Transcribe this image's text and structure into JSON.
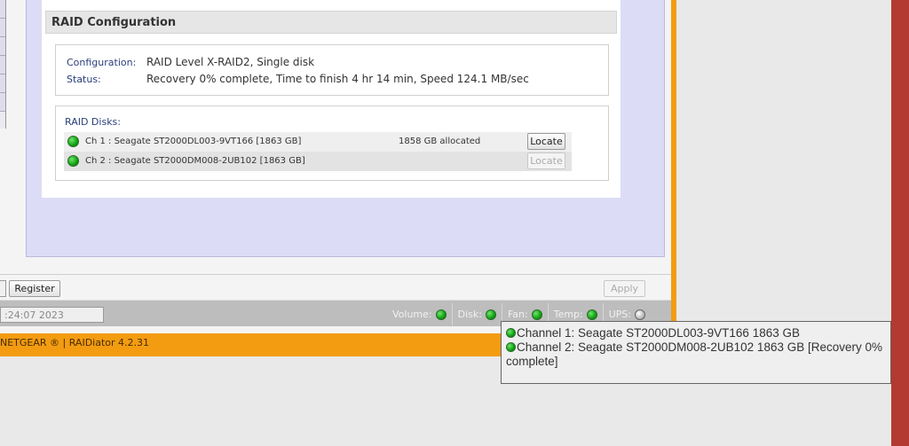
{
  "raid": {
    "title": "RAID Configuration",
    "configuration_label": "Configuration:",
    "configuration_value": "RAID Level X-RAID2, Single disk",
    "status_label": "Status:",
    "status_value": "Recovery 0% complete, Time to finish 4 hr 14 min, Speed 124.1 MB/sec",
    "disks_label": "RAID Disks:",
    "disks": [
      {
        "name": "Ch 1 : Seagate ST2000DL003-9VT166 [1863 GB]",
        "allocated": "1858 GB allocated",
        "button": "Locate",
        "button_enabled": true
      },
      {
        "name": "Ch 2 : Seagate ST2000DM008-2UB102 [1863 GB]",
        "allocated": "",
        "button": "Locate",
        "button_enabled": false
      }
    ]
  },
  "actions": {
    "register_label": "Register",
    "apply_label": "Apply"
  },
  "status_bar": {
    "time_text": ":24:07 2023",
    "items": [
      {
        "label": "Volume:",
        "state": "ok"
      },
      {
        "label": "Disk:",
        "state": "ok"
      },
      {
        "label": "Fan:",
        "state": "ok"
      },
      {
        "label": "Temp:",
        "state": "ok"
      },
      {
        "label": "UPS:",
        "state": "off"
      }
    ]
  },
  "footer": {
    "text": "NETGEAR ® | RAIDiator 4.2.31"
  },
  "tooltip": {
    "line1": "Channel 1: Seagate ST2000DL003-9VT166 1863 GB",
    "line2": "Channel 2: Seagate ST2000DM008-2UB102 1863 GB [Recovery 0% complete]"
  },
  "colors": {
    "frame_orange": "#f39c12",
    "content_lavender": "#dcdcf6",
    "led_green": "#0ea10e",
    "right_strip": "#b23a30"
  }
}
